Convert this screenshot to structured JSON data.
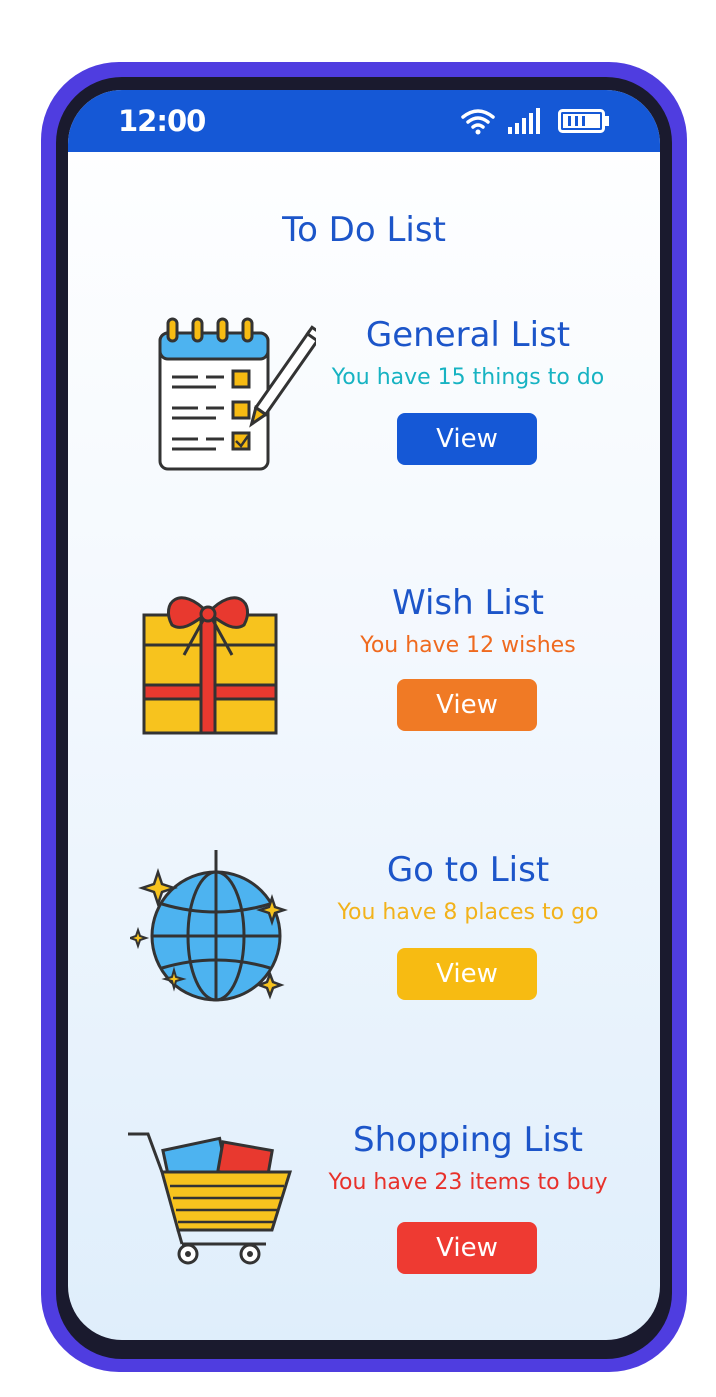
{
  "status_bar": {
    "time": "12:00"
  },
  "page": {
    "title": "To Do List"
  },
  "lists": [
    {
      "title": "General List",
      "subtitle": "You have 15 things to do",
      "button": "View",
      "icon": "notepad-checklist-icon",
      "color": "#17b3c2",
      "button_color": "#1558d6"
    },
    {
      "title": "Wish List",
      "subtitle": "You have 12  wishes",
      "button": "View",
      "icon": "gift-box-icon",
      "color": "#ef6a1f",
      "button_color": "#f07a25"
    },
    {
      "title": "Go to List",
      "subtitle": "You have 8 places to go",
      "button": "View",
      "icon": "globe-icon",
      "color": "#f2b21b",
      "button_color": "#f7bb12"
    },
    {
      "title": "Shopping List",
      "subtitle": "You have 23 items to buy",
      "button": "View",
      "icon": "shopping-cart-icon",
      "color": "#e8312b",
      "button_color": "#ee3a32"
    }
  ]
}
